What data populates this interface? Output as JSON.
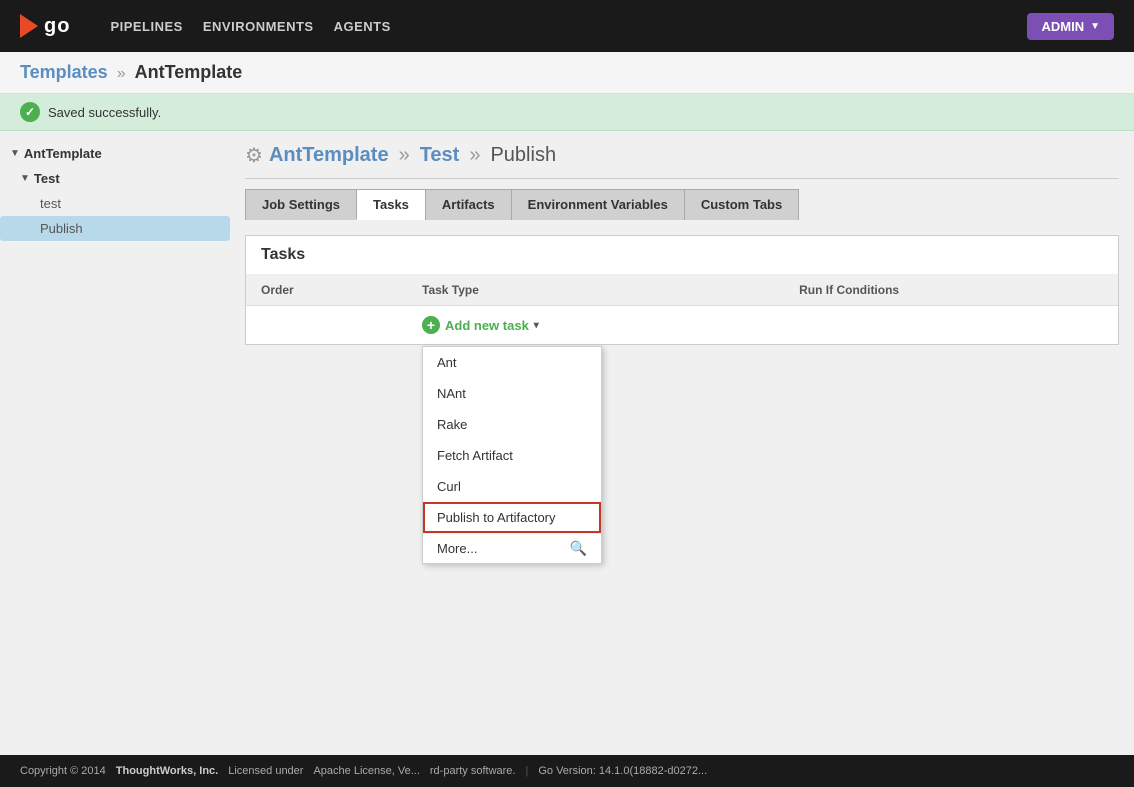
{
  "topnav": {
    "logo_text": "go",
    "nav_items": [
      {
        "label": "PIPELINES",
        "id": "pipelines"
      },
      {
        "label": "ENVIRONMENTS",
        "id": "environments"
      },
      {
        "label": "AGENTS",
        "id": "agents"
      }
    ],
    "admin_label": "ADMIN"
  },
  "breadcrumb": {
    "templates_label": "Templates",
    "separator": "»",
    "current": "AntTemplate"
  },
  "success": {
    "message": "Saved successfully."
  },
  "sidebar": {
    "items": [
      {
        "label": "AntTemplate",
        "level": 0,
        "arrow": "▼",
        "active": false
      },
      {
        "label": "Test",
        "level": 1,
        "arrow": "▼",
        "active": false
      },
      {
        "label": "test",
        "level": 2,
        "active": false
      },
      {
        "label": "Publish",
        "level": 2,
        "active": true
      }
    ]
  },
  "page_heading": {
    "template_name": "AntTemplate",
    "sep1": "»",
    "stage_name": "Test",
    "sep2": "»",
    "job_name": "Publish"
  },
  "tabs": [
    {
      "label": "Job Settings",
      "id": "job-settings",
      "active": false
    },
    {
      "label": "Tasks",
      "id": "tasks",
      "active": true
    },
    {
      "label": "Artifacts",
      "id": "artifacts",
      "active": false
    },
    {
      "label": "Environment Variables",
      "id": "env-vars",
      "active": false
    },
    {
      "label": "Custom Tabs",
      "id": "custom-tabs",
      "active": false
    }
  ],
  "tasks_section": {
    "title": "Tasks",
    "table_headers": [
      "Order",
      "Task Type",
      "Run If Conditions"
    ]
  },
  "add_task": {
    "label": "Add new task",
    "dropdown_arrow": "▾"
  },
  "dropdown": {
    "items": [
      {
        "label": "Ant",
        "highlighted": false
      },
      {
        "label": "NAnt",
        "highlighted": false
      },
      {
        "label": "Rake",
        "highlighted": false
      },
      {
        "label": "Fetch Artifact",
        "highlighted": false
      },
      {
        "label": "Curl",
        "highlighted": false
      },
      {
        "label": "Publish to Artifactory",
        "highlighted": true
      },
      {
        "label": "More...",
        "highlighted": false,
        "is_more": true
      }
    ]
  },
  "footer": {
    "copyright": "Copyright © 2014",
    "company": "ThoughtWorks, Inc.",
    "license_text": "Licensed under",
    "license_link": "Apache License, Ve...",
    "third_party": "rd-party software.",
    "divider": "|",
    "version": "Go Version: 14.1.0(18882-d0272..."
  }
}
